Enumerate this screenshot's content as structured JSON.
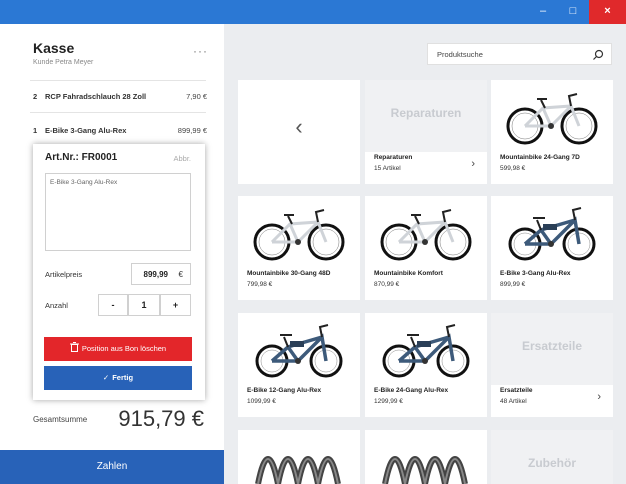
{
  "window": {
    "controls": {
      "minimize": "–",
      "maximize": "□",
      "close": "×"
    }
  },
  "kasse": {
    "title": "Kasse",
    "customer": "Kunde Petra Meyer",
    "more": "···",
    "items": [
      {
        "qty": "2",
        "name": "RCP Fahradschlauch 28 Zoll",
        "price": "7,90 €"
      },
      {
        "qty": "1",
        "name": "E-Bike 3-Gang Alu-Rex",
        "price": "899,99 €"
      }
    ],
    "total_label": "Gesamtsumme",
    "total_value": "915,79 €",
    "pay_button": "Zahlen"
  },
  "editor": {
    "art_nr": "Art.Nr.: FR0001",
    "abbr": "Abbr.",
    "description": "E-Bike 3-Gang Alu-Rex",
    "price_label": "Artikelpreis",
    "price_value": "899,99",
    "currency": "€",
    "qty_label": "Anzahl",
    "minus": "-",
    "qty_value": "1",
    "plus": "+",
    "delete_button": "Position aus Bon löschen",
    "done_button": "Fertig"
  },
  "search": {
    "placeholder": "Produktsuche"
  },
  "grid": {
    "back": "‹",
    "categories": [
      {
        "title": "Reparaturen",
        "name": "Reparaturen",
        "count": "15 Artikel"
      },
      {
        "title": "Ersatzteile",
        "name": "Ersatzteile",
        "count": "48 Artikel"
      },
      {
        "title": "Zubehör"
      }
    ],
    "products": [
      {
        "name": "Mountainbike 24-Gang 7D",
        "price": "599,98 €"
      },
      {
        "name": "Mountainbike 30-Gang 48D",
        "price": "799,98 €"
      },
      {
        "name": "Mountainbike Komfort",
        "price": "870,99 €"
      },
      {
        "name": "E-Bike 3-Gang Alu-Rex",
        "price": "899,99 €"
      },
      {
        "name": "E-Bike 12-Gang Alu-Rex",
        "price": "1099,99 €"
      },
      {
        "name": "E-Bike 24-Gang Alu-Rex",
        "price": "1299,99 €"
      }
    ]
  },
  "colors": {
    "accent": "#2b78d4",
    "primary_button": "#2862b8",
    "danger": "#e3262a",
    "bike_frame": "#ffffff",
    "ebike_frame": "#3d5a7a"
  }
}
